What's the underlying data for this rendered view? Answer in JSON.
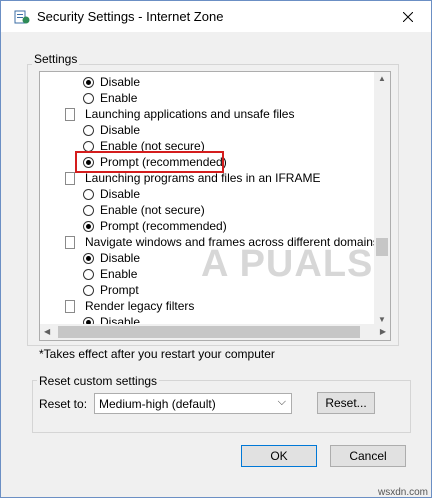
{
  "window": {
    "title": "Security Settings - Internet Zone"
  },
  "settings": {
    "group_label": "Settings",
    "rows": [
      {
        "type": "radio",
        "checked": true,
        "label": "Disable"
      },
      {
        "type": "radio",
        "checked": false,
        "label": "Enable"
      },
      {
        "type": "category",
        "label": "Launching applications and unsafe files"
      },
      {
        "type": "radio",
        "checked": false,
        "label": "Disable"
      },
      {
        "type": "radio",
        "checked": false,
        "label": "Enable (not secure)"
      },
      {
        "type": "radio",
        "checked": true,
        "label": "Prompt (recommended)"
      },
      {
        "type": "category",
        "label": "Launching programs and files in an IFRAME"
      },
      {
        "type": "radio",
        "checked": false,
        "label": "Disable"
      },
      {
        "type": "radio",
        "checked": false,
        "label": "Enable (not secure)"
      },
      {
        "type": "radio",
        "checked": true,
        "label": "Prompt (recommended)"
      },
      {
        "type": "category",
        "label": "Navigate windows and frames across different domains"
      },
      {
        "type": "radio",
        "checked": true,
        "label": "Disable"
      },
      {
        "type": "radio",
        "checked": false,
        "label": "Enable"
      },
      {
        "type": "radio",
        "checked": false,
        "label": "Prompt"
      },
      {
        "type": "category",
        "label": "Render legacy filters"
      },
      {
        "type": "radio",
        "checked": true,
        "label": "Disable"
      }
    ],
    "note": "*Takes effect after you restart your computer"
  },
  "reset": {
    "group_label": "Reset custom settings",
    "reset_to_label": "Reset to:",
    "selected_level": "Medium-high (default)",
    "reset_button": "Reset..."
  },
  "footer": {
    "ok": "OK",
    "cancel": "Cancel"
  },
  "watermark": "A PUALS",
  "site": "wsxdn.com",
  "colors": {
    "highlight": "#d41d1d",
    "accent": "#0078d7",
    "background": "#f0f0f0"
  }
}
